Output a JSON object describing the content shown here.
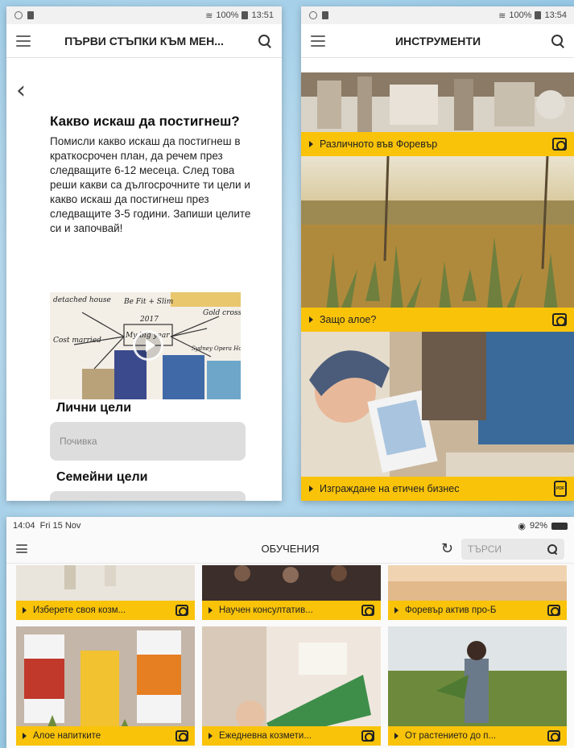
{
  "phone_left": {
    "status": {
      "time": "13:51",
      "battery": "100%"
    },
    "title": "ПЪРВИ СТЪПКИ КЪМ МЕН...",
    "heading": "Какво искаш да постигнеш?",
    "body": "Помисли какво искаш да постигнеш в краткосрочен план, да речем през следващите 6-12 месеца.  След това реши какви са дългосрочните ти цели и какво искаш да постигнеш през следващите 3-5 години.  Запиши целите си и започвай!",
    "video_texts": [
      "detached house",
      "Be Fit + Slim",
      "2017",
      "My big year",
      "Cost married",
      "Gold cross",
      "Sydney Opera House"
    ],
    "personal_goals_label": "Лични цели",
    "personal_goals_placeholder": "Почивка",
    "family_goals_label": "Семейни цели"
  },
  "phone_right": {
    "status": {
      "time": "13:54",
      "battery": "100%"
    },
    "title": "ИНСТРУМЕНТИ",
    "tiles": [
      {
        "label": "Различното във Форевър",
        "icon": "video-icon"
      },
      {
        "label": "Защо алое?",
        "icon": "video-icon"
      },
      {
        "label": "Изграждане на етичен бизнес",
        "icon": "pdf-icon"
      }
    ]
  },
  "tablet": {
    "status": {
      "time": "14:04",
      "date": "Fri 15 Nov",
      "battery": "92%"
    },
    "title": "ОБУЧЕНИЯ",
    "search_placeholder": "ТЪРСИ",
    "tiles": [
      {
        "label": "Изберете своя козм...",
        "icon": "video-icon"
      },
      {
        "label": "Научен консултатив...",
        "icon": "video-icon"
      },
      {
        "label": "Форевър актив про-Б",
        "icon": "video-icon"
      },
      {
        "label": "Алое напитките",
        "icon": "video-icon"
      },
      {
        "label": "Ежедневна козмети...",
        "icon": "video-icon"
      },
      {
        "label": "От растението до п...",
        "icon": "video-icon"
      }
    ]
  },
  "colors": {
    "accent": "#f9c30a",
    "background": "#a9d2ea"
  }
}
